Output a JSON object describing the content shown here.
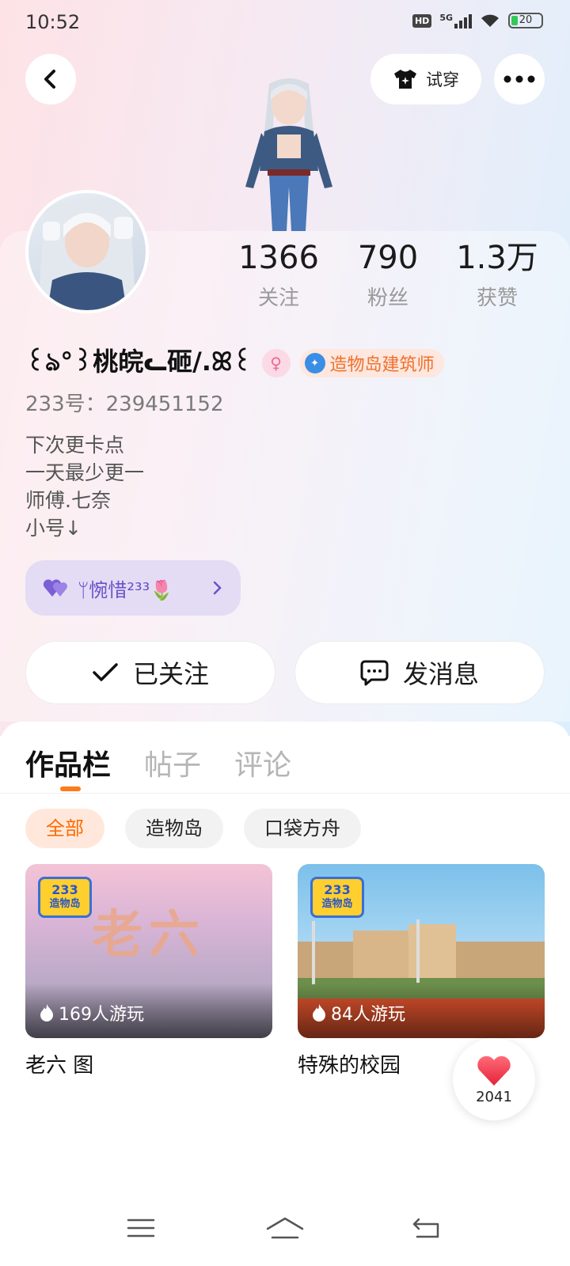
{
  "status_bar": {
    "time": "10:52",
    "hd": "HD",
    "network": "5G",
    "battery": "20",
    "icons": [
      "hd-icon",
      "signal-5g-icon",
      "wifi-icon",
      "battery-icon"
    ]
  },
  "header": {
    "back_icon": "chevron-left-icon",
    "try_on_icon": "tshirt-sparkle-icon",
    "try_on_label": "试穿",
    "more_icon": "more-dots-icon"
  },
  "profile": {
    "stats": [
      {
        "value": "1366",
        "label": "关注"
      },
      {
        "value": "790",
        "label": "粉丝"
      },
      {
        "value": "1.3万",
        "label": "获赞"
      }
    ],
    "nickname": "꒰ঌ°꒱桃皖ᓚ砸/.ꕤ꒰",
    "gender_icon": "female-icon",
    "builder_badge": "造物岛建筑师",
    "uid": "233号：239451152",
    "bio_lines": [
      "下次更卡点",
      "一天最少更一",
      "师傅.七奈",
      "小号↓"
    ],
    "relation": {
      "heart_icon": "double-heart-icon",
      "label": "ᛘ惋惜²³³🌷",
      "chevron_icon": "chevron-right-icon"
    }
  },
  "actions": {
    "follow_label": "已关注",
    "follow_icon": "check-icon",
    "message_label": "发消息",
    "message_icon": "chat-bubble-icon"
  },
  "tabs": [
    {
      "label": "作品栏",
      "active": true
    },
    {
      "label": "帖子",
      "active": false
    },
    {
      "label": "评论",
      "active": false
    }
  ],
  "filters": [
    {
      "label": "全部",
      "active": true
    },
    {
      "label": "造物岛",
      "active": false
    },
    {
      "label": "口袋方舟",
      "active": false
    }
  ],
  "works": [
    {
      "title": "老六 图",
      "plays": "169人游玩",
      "logo_top": "233",
      "logo_bottom": "造物岛",
      "thumb_text": "老六"
    },
    {
      "title": "特殊的校园",
      "plays": "84人游玩",
      "logo_top": "233",
      "logo_bottom": "造物岛"
    }
  ],
  "like_button": {
    "icon": "heart-icon",
    "count": "2041"
  },
  "nav": [
    "menu-icon",
    "home-icon",
    "back-icon"
  ],
  "colors": {
    "accent": "#ff7a1a",
    "builder_badge_text": "#f0702c",
    "relation_pill_bg": "#e4dcf5",
    "relation_text": "#6a52c9",
    "like_red": "#f23b4c"
  }
}
